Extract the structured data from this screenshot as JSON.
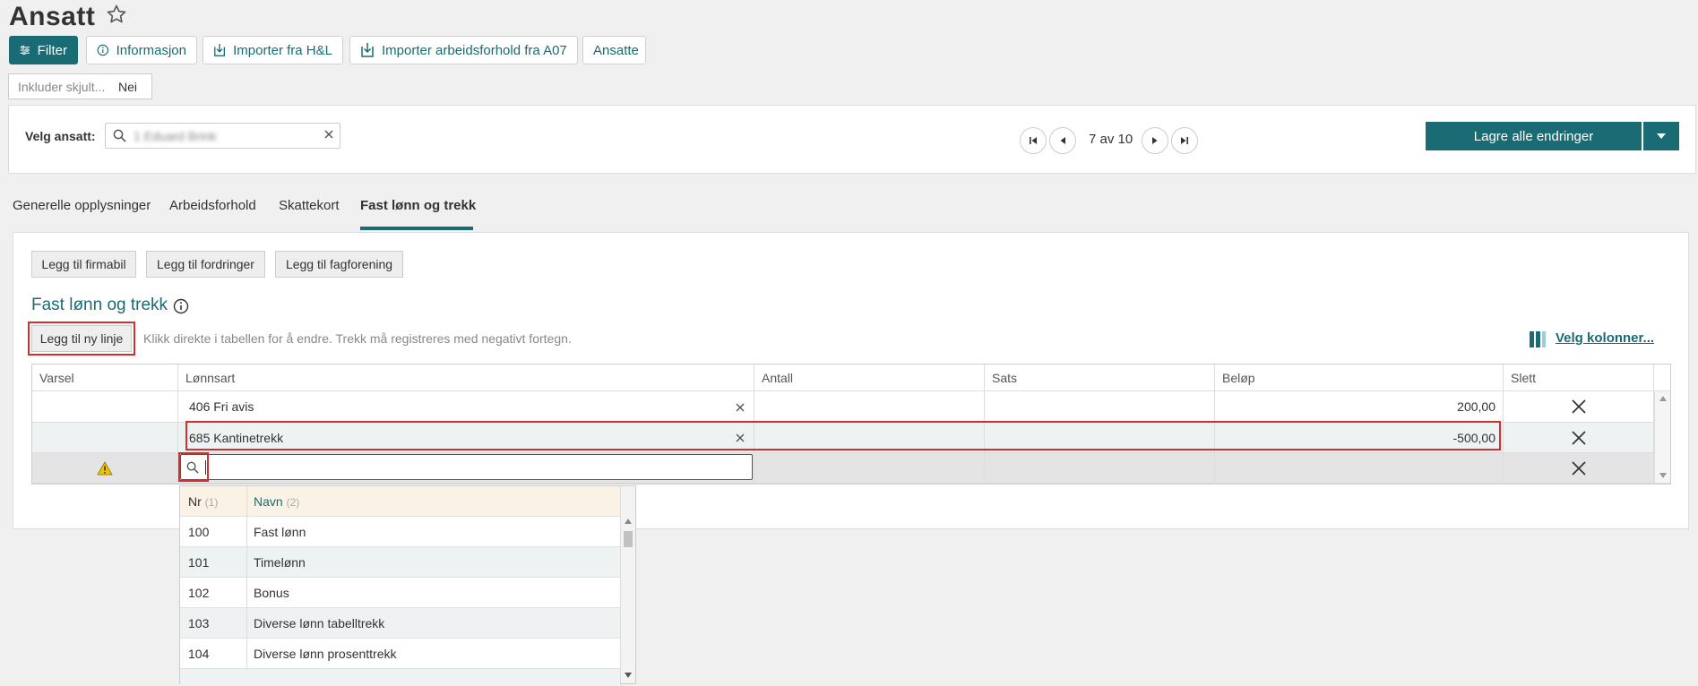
{
  "header": {
    "title": "Ansatt"
  },
  "toolbar": {
    "filter": "Filter",
    "informasjon": "Informasjon",
    "import_hl": "Importer fra H&L",
    "import_a07": "Importer arbeidsforhold fra A07",
    "ansatte": "Ansatte"
  },
  "hidden_filter": {
    "label": "Inkluder skjult...",
    "value": "Nei"
  },
  "employee_selector": {
    "label": "Velg ansatt:",
    "value": "1 Eduard Brink"
  },
  "pager": {
    "text": "7 av 10"
  },
  "save": {
    "label": "Lagre alle endringer"
  },
  "tabs": [
    {
      "label": "Generelle opplysninger"
    },
    {
      "label": "Arbeidsforhold"
    },
    {
      "label": "Skattekort"
    },
    {
      "label": "Fast lønn og trekk"
    }
  ],
  "buttons": {
    "firmabil": "Legg til firmabil",
    "fordringer": "Legg til fordringer",
    "fagforening": "Legg til fagforening",
    "new_line": "Legg til ny linje"
  },
  "section": {
    "title": "Fast lønn og trekk",
    "hint": "Klikk direkte i tabellen for å endre. Trekk må registreres med negativt fortegn.",
    "choose_columns": "Velg kolonner..."
  },
  "grid": {
    "columns": [
      "Varsel",
      "Lønnsart",
      "Antall",
      "Sats",
      "Beløp",
      "Slett"
    ],
    "rows": [
      {
        "varsel": "",
        "lonnsart": "406 Fri avis",
        "antall": "",
        "sats": "",
        "belop": "200,00"
      },
      {
        "varsel": "",
        "lonnsart": "685 Kantinetrekk",
        "antall": "",
        "sats": "",
        "belop": "-500,00"
      },
      {
        "varsel": "warning",
        "lonnsart": "",
        "antall": "",
        "sats": "",
        "belop": ""
      }
    ]
  },
  "dropdown": {
    "headers": {
      "nr": "Nr",
      "nr_sort": "(1)",
      "navn": "Navn",
      "navn_sort": "(2)"
    },
    "items": [
      {
        "nr": "100",
        "navn": "Fast lønn"
      },
      {
        "nr": "101",
        "navn": "Timelønn"
      },
      {
        "nr": "102",
        "navn": "Bonus"
      },
      {
        "nr": "103",
        "navn": "Diverse lønn tabelltrekk"
      },
      {
        "nr": "104",
        "navn": "Diverse lønn prosenttrekk"
      }
    ]
  },
  "colors": {
    "accent": "#1a6b73",
    "highlight": "#d32f2f",
    "warning": "#f2c200",
    "dropdown_header": "#fbf2e6"
  }
}
